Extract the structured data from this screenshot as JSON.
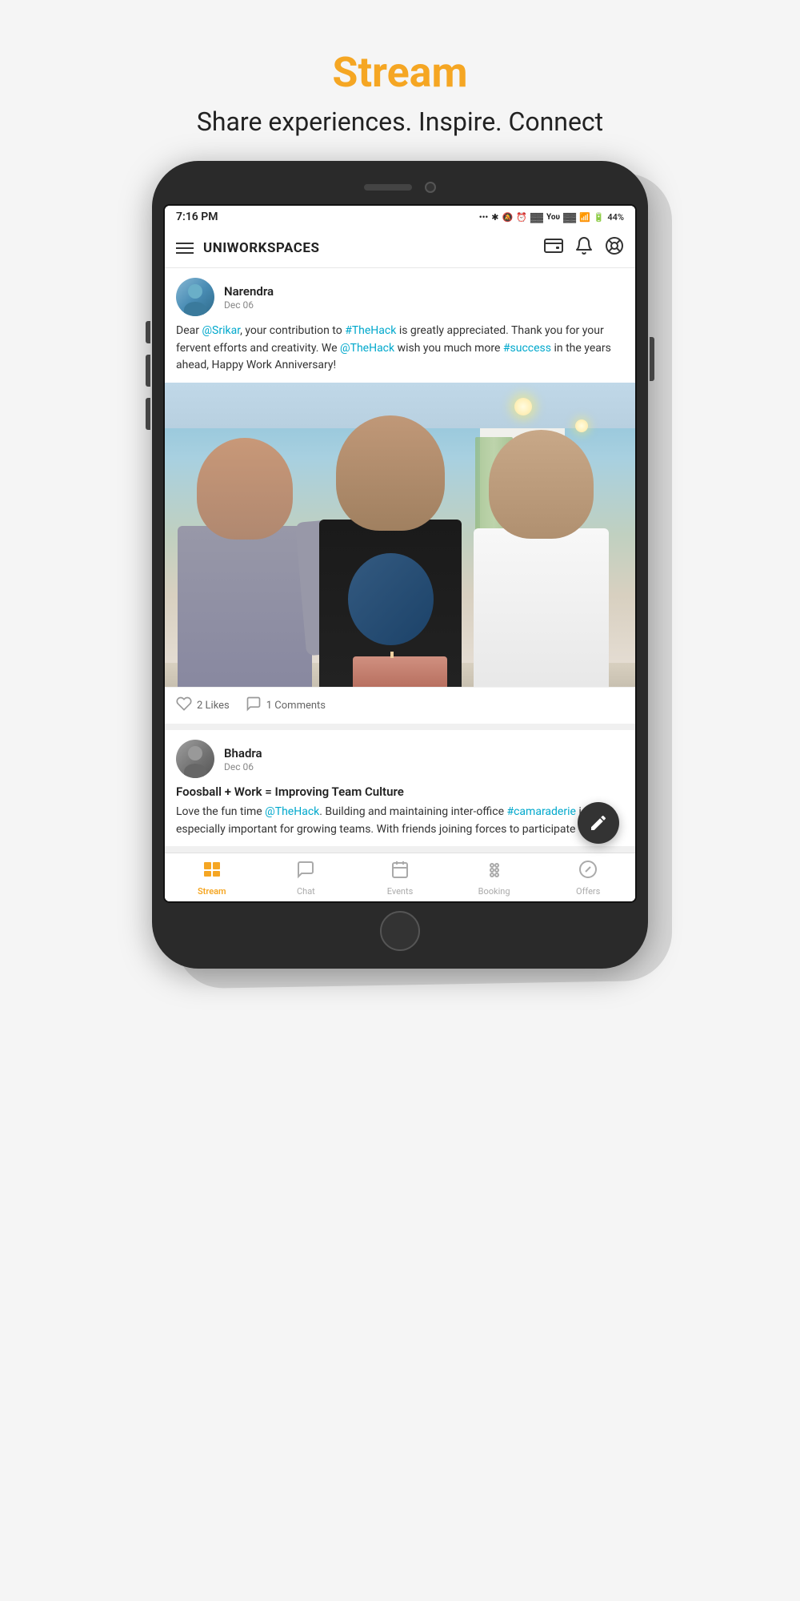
{
  "header": {
    "title": "Stream",
    "subtitle": "Share experiences. Inspire. Connect",
    "title_color": "#f5a623"
  },
  "phone": {
    "status_bar": {
      "time": "7:16 PM",
      "battery": "44%",
      "icons": "... ♦ 🔔 ⏰ ▊ You ▊ ▊ ◀ ▮"
    },
    "app_bar": {
      "title": "UNIWORKSPACES",
      "menu_icon": "menu",
      "wallet_icon": "wallet",
      "bell_icon": "bell",
      "help_icon": "help-circle"
    },
    "feed": {
      "posts": [
        {
          "id": "post-1",
          "author": "Narendra",
          "date": "Dec 06",
          "text_parts": [
            {
              "type": "normal",
              "text": "Dear "
            },
            {
              "type": "mention",
              "text": "@Srikar"
            },
            {
              "type": "normal",
              "text": ", your contribution to "
            },
            {
              "type": "hashtag",
              "text": "#TheHack"
            },
            {
              "type": "normal",
              "text": " is greatly appreciated. Thank you for your fervent efforts and creativity. We "
            },
            {
              "type": "mention",
              "text": "@TheHack"
            },
            {
              "type": "normal",
              "text": " wish you much more "
            },
            {
              "type": "hashtag",
              "text": "#success"
            },
            {
              "type": "normal",
              "text": " in the years ahead, Happy Work Anniversary!"
            }
          ],
          "likes": "2 Likes",
          "comments": "1 Comments",
          "has_image": true
        },
        {
          "id": "post-2",
          "author": "Bhadra",
          "date": "Dec 06",
          "title": "Foosball + Work = Improving Team Culture",
          "text": "Love the fun time @TheHack. Building and maintaining inter-office #camaraderie is especially important for growing teams. With friends joining forces to participate"
        }
      ]
    },
    "bottom_nav": {
      "items": [
        {
          "id": "stream",
          "label": "Stream",
          "active": true,
          "icon": "stream"
        },
        {
          "id": "chat",
          "label": "Chat",
          "active": false,
          "icon": "chat"
        },
        {
          "id": "events",
          "label": "Events",
          "active": false,
          "icon": "events"
        },
        {
          "id": "booking",
          "label": "Booking",
          "active": false,
          "icon": "booking"
        },
        {
          "id": "offers",
          "label": "Offers",
          "active": false,
          "icon": "offers"
        }
      ]
    }
  }
}
